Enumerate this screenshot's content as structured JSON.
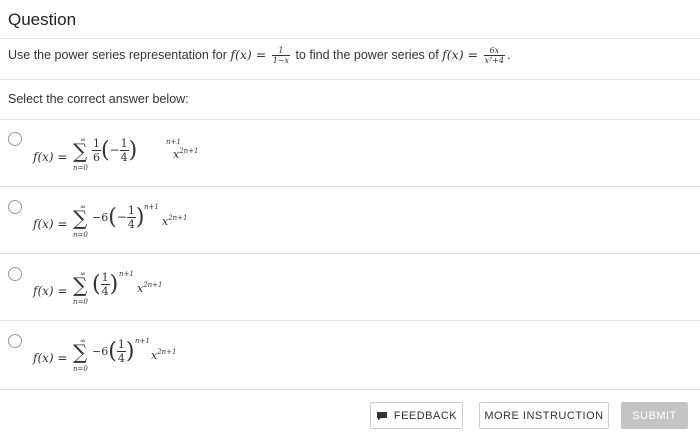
{
  "header": {
    "title": "Question"
  },
  "question": {
    "prompt_prefix": "Use the power series representation for",
    "prompt_middle": "to find the power series of",
    "f_lhs": "f(x) =",
    "f1_num": "1",
    "f1_den": "1−x",
    "f2_num": "6x",
    "f2_den": "x²+4",
    "period": "."
  },
  "select_label": "Select the correct answer below:",
  "options": [
    {
      "lhs": "f(x) =",
      "sum_top": "∞",
      "sum_bottom": "n=0",
      "coef_num": "1",
      "coef_den": "6",
      "inner_sign": "−",
      "inner_num": "1",
      "inner_den": "4",
      "exponent": "n+1",
      "x_power_base": "x",
      "x_power_exp": "2n+1"
    },
    {
      "lhs": "f(x) =",
      "sum_top": "∞",
      "sum_bottom": "n=0",
      "coef": "−6",
      "inner_sign": "−",
      "inner_num": "1",
      "inner_den": "4",
      "exponent": "n+1",
      "x_power_base": "x",
      "x_power_exp": "2n+1"
    },
    {
      "lhs": "f(x) =",
      "sum_top": "∞",
      "sum_bottom": "n=0",
      "inner_num": "1",
      "inner_den": "4",
      "exponent": "n+1",
      "x_power_base": "x",
      "x_power_exp": "2n+1"
    },
    {
      "lhs": "f(x) =",
      "sum_top": "∞",
      "sum_bottom": "n=0",
      "coef": "−6",
      "inner_num": "1",
      "inner_den": "4",
      "exponent": "n+1",
      "x_power_base": "x",
      "x_power_exp": "2n+1"
    }
  ],
  "buttons": {
    "feedback": "FEEDBACK",
    "more_instruction": "MORE INSTRUCTION",
    "submit": "SUBMIT"
  },
  "icons": {
    "feedback": "flag-icon"
  },
  "colors": {
    "submit_bg": "#c4c4c4",
    "border": "#cccccc",
    "divider": "#e2e2e2"
  }
}
